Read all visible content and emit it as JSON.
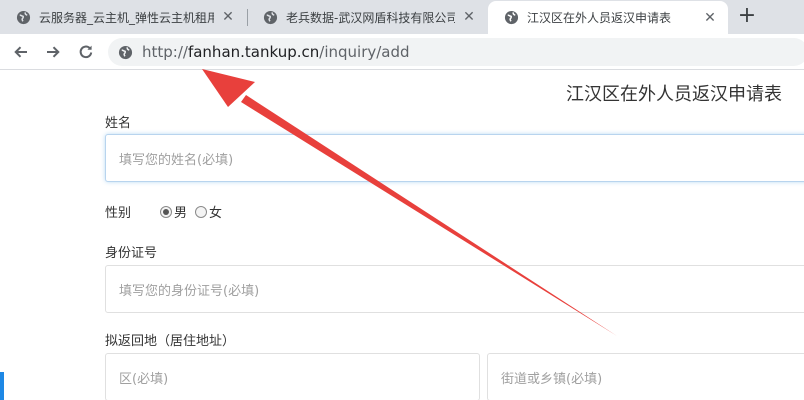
{
  "browser": {
    "tabs": [
      {
        "title": "云服务器_云主机_弹性云主机租用",
        "active": false
      },
      {
        "title": "老兵数据-武汉网盾科技有限公司",
        "active": false
      },
      {
        "title": "江汉区在外人员返汉申请表",
        "active": true
      }
    ],
    "tab_close_glyph": "✕",
    "new_tab_glyph": "+",
    "url_scheme": "http://",
    "url_host": "fanhan.tankup.cn",
    "url_path": "/inquiry/add"
  },
  "form": {
    "title": "江汉区在外人员返汉申请表",
    "name_label": "姓名",
    "name_placeholder": "填写您的姓名(必填)",
    "gender_label": "性别",
    "gender_options": [
      "男",
      "女"
    ],
    "gender_selected": "男",
    "id_label": "身份证号",
    "id_placeholder": "填写您的身份证号(必填)",
    "address_label": "拟返回地（居住地址）",
    "district_placeholder": "区(必填)",
    "street_placeholder": "街道或乡镇(必填)"
  },
  "colors": {
    "annotation_arrow": "#e8403c",
    "tabstrip_bg": "#dee1e6",
    "focus_border": "#b8d4ee"
  },
  "icons": [
    "globe-icon",
    "back-arrow-icon",
    "forward-arrow-icon",
    "reload-icon",
    "close-icon",
    "plus-icon"
  ]
}
